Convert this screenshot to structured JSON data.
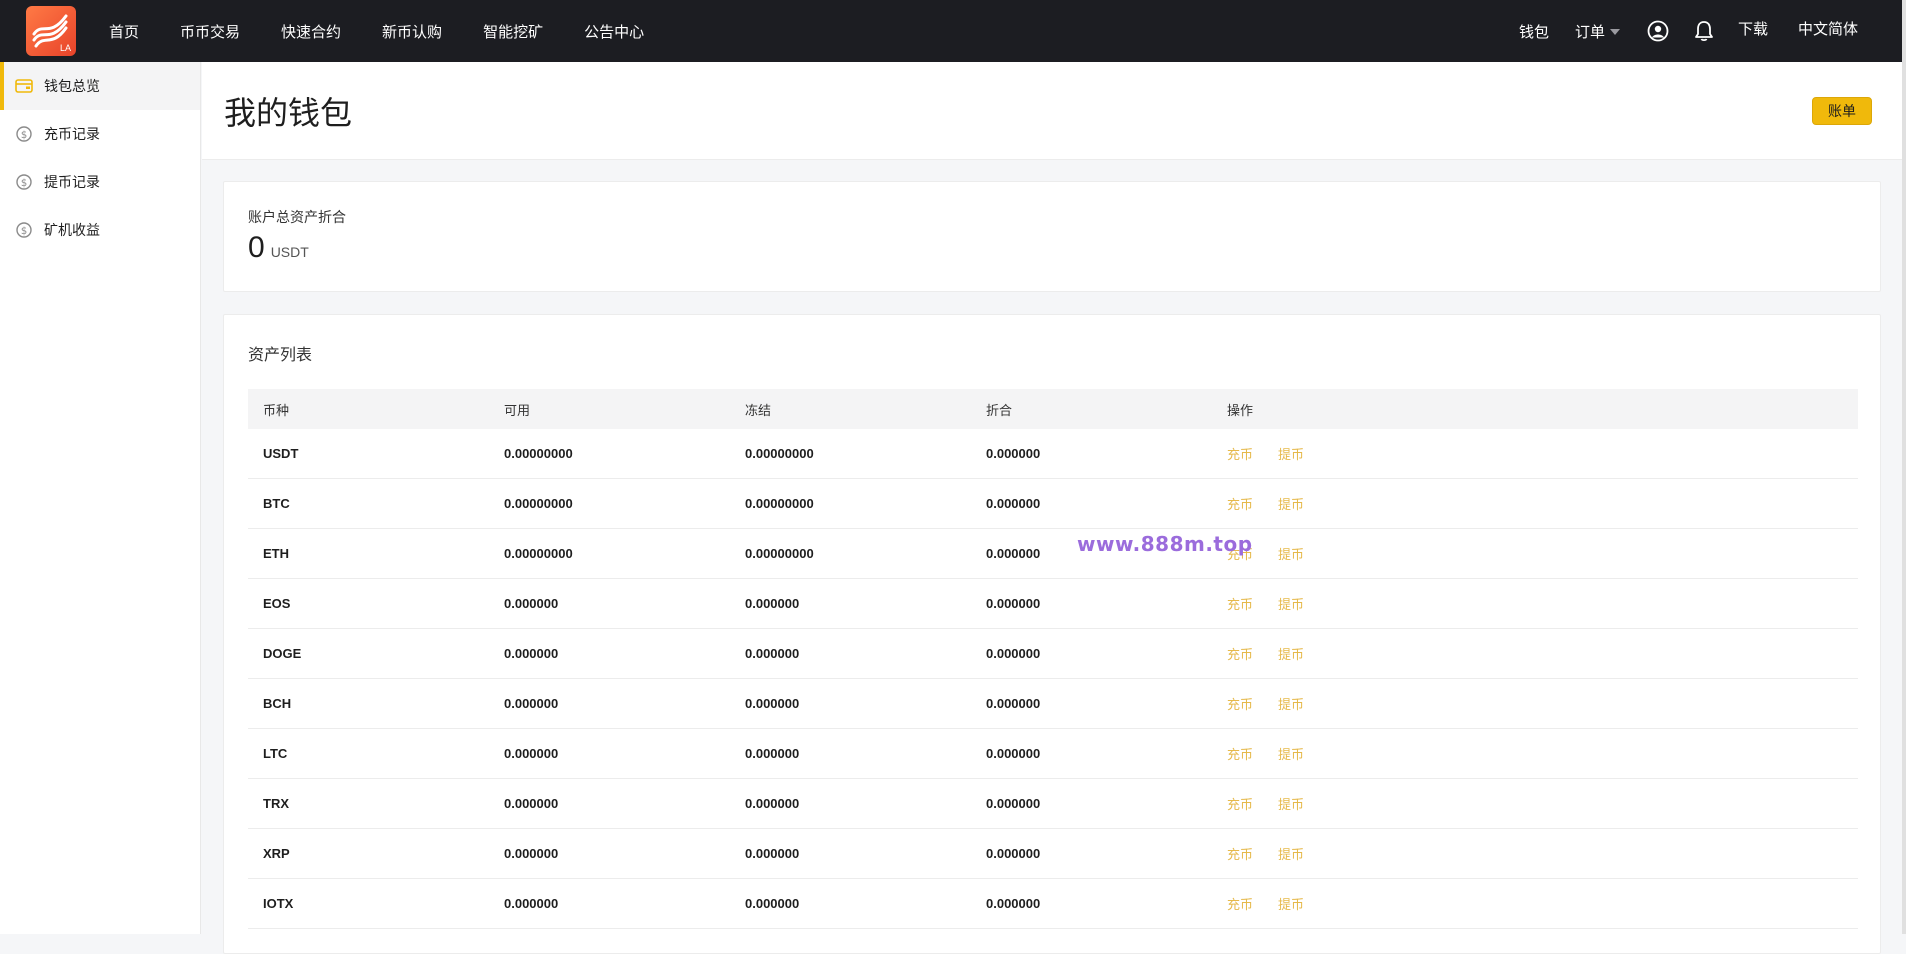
{
  "topbar": {
    "logo_text": "LA",
    "nav": [
      "首页",
      "币币交易",
      "快速合约",
      "新币认购",
      "智能挖矿",
      "公告中心"
    ],
    "wallet_label": "钱包",
    "orders_label": "订单",
    "download_label": "下载",
    "language_label": "中文简体"
  },
  "sidebar": {
    "items": [
      {
        "label": "钱包总览",
        "icon": "wallet-icon",
        "active": true
      },
      {
        "label": "充币记录",
        "icon": "dollar-circle-icon",
        "active": false
      },
      {
        "label": "提币记录",
        "icon": "dollar-circle-icon",
        "active": false
      },
      {
        "label": "矿机收益",
        "icon": "dollar-circle-icon",
        "active": false
      }
    ]
  },
  "header": {
    "title": "我的钱包",
    "bill_button": "账单"
  },
  "total": {
    "label": "账户总资产折合",
    "value": "0",
    "unit": "USDT"
  },
  "assets": {
    "title": "资产列表",
    "columns": [
      "币种",
      "可用",
      "冻结",
      "折合",
      "操作"
    ],
    "deposit_label": "充币",
    "withdraw_label": "提币",
    "rows": [
      {
        "coin": "USDT",
        "available": "0.00000000",
        "frozen": "0.00000000",
        "converted": "0.000000"
      },
      {
        "coin": "BTC",
        "available": "0.00000000",
        "frozen": "0.00000000",
        "converted": "0.000000"
      },
      {
        "coin": "ETH",
        "available": "0.00000000",
        "frozen": "0.00000000",
        "converted": "0.000000"
      },
      {
        "coin": "EOS",
        "available": "0.000000",
        "frozen": "0.000000",
        "converted": "0.000000"
      },
      {
        "coin": "DOGE",
        "available": "0.000000",
        "frozen": "0.000000",
        "converted": "0.000000"
      },
      {
        "coin": "BCH",
        "available": "0.000000",
        "frozen": "0.000000",
        "converted": "0.000000"
      },
      {
        "coin": "LTC",
        "available": "0.000000",
        "frozen": "0.000000",
        "converted": "0.000000"
      },
      {
        "coin": "TRX",
        "available": "0.000000",
        "frozen": "0.000000",
        "converted": "0.000000"
      },
      {
        "coin": "XRP",
        "available": "0.000000",
        "frozen": "0.000000",
        "converted": "0.000000"
      },
      {
        "coin": "IOTX",
        "available": "0.000000",
        "frozen": "0.000000",
        "converted": "0.000000"
      }
    ]
  },
  "watermark": "www.888m.top",
  "colors": {
    "topbar_bg": "#1c1d22",
    "accent": "#f0b90b",
    "op_link": "#e6b94a",
    "watermark": "#9b6cdc"
  }
}
